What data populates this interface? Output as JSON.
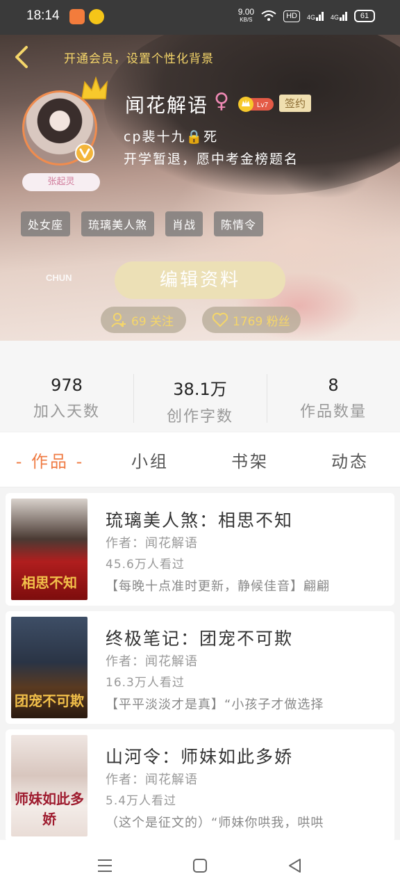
{
  "status_bar": {
    "time": "18:14",
    "net_speed": "9.00",
    "net_unit": "KB/S",
    "hd_label": "HD",
    "signal1": "4G",
    "signal2": "4G",
    "battery": "61"
  },
  "header": {
    "vip_banner": "开通会员，设置个性化背景",
    "avatar_nickname": "张起灵",
    "username": "闻花解语",
    "gender_symbol": "♀",
    "level": "Lv7",
    "signed_badge": "签约",
    "bio_line1": "cp裴十九🔒死",
    "bio_line2": "开学暂退，愿中考金榜题名",
    "tags": [
      "处女座",
      "琉璃美人煞",
      "肖战",
      "陈情令"
    ],
    "watermark": "CHUN",
    "edit_button": "编辑资料",
    "following": "69 关注",
    "fans": "1769 粉丝"
  },
  "stats": [
    {
      "value": "978",
      "label": "加入天数"
    },
    {
      "value": "38.1万",
      "label": "创作字数"
    },
    {
      "value": "8",
      "label": "作品数量"
    }
  ],
  "tabs": [
    "- 作品 -",
    "小组",
    "书架",
    "动态"
  ],
  "books": [
    {
      "title": "琉璃美人煞：相思不知",
      "author": "作者：闻花解语",
      "views": "45.6万人看过",
      "desc": "【每晚十点准时更新，静候佳音】翩翩",
      "cover_text": "相思不知"
    },
    {
      "title": "终极笔记：团宠不可欺",
      "author": "作者：闻花解语",
      "views": "16.3万人看过",
      "desc": "【平平淡淡才是真】“小孩子才做选择",
      "cover_text": "团宠不可欺"
    },
    {
      "title": "山河令：师妹如此多娇",
      "author": "作者：闻花解语",
      "views": "5.4万人看过",
      "desc": "（这个是征文的）“师妹你哄我，哄哄",
      "cover_text": "师妹如此多娇"
    }
  ],
  "icons": {
    "back": "back-arrow-icon",
    "crown": "crown-icon",
    "verified": "verified-v-icon",
    "follow": "add-person-icon",
    "fans": "heart-icon"
  },
  "colors": {
    "accent": "#ef7b43",
    "gold": "#f5d66a",
    "edit_button": "#ece0b6"
  }
}
